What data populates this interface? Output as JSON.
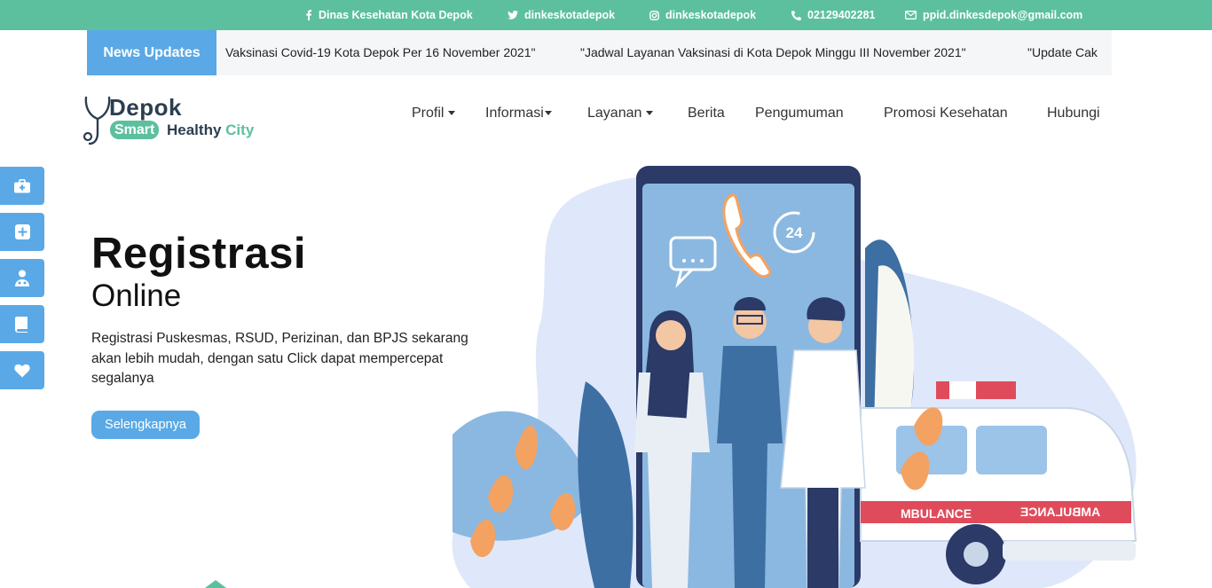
{
  "topbar": {
    "facebook": "Dinas Kesehatan Kota Depok",
    "twitter": "dinkeskotadepok",
    "instagram": "dinkeskotadepok",
    "phone": "02129402281",
    "email": "ppid.dinkesdepok@gmail.com"
  },
  "news": {
    "label": "News Updates",
    "items": [
      "Vaksinasi Covid-19 Kota Depok Per 16 November 2021\"",
      "\"Jadwal Layanan Vaksinasi di Kota Depok Minggu III November 2021\"",
      "\"Update Cak"
    ]
  },
  "logo": {
    "depok": "Depok",
    "smart": "Smart",
    "healthy": "Healthy",
    "city": "City"
  },
  "nav": {
    "items": [
      "Profil",
      "Informasi",
      "Layanan",
      "Berita",
      "Pengumuman",
      "Promosi Kesehatan",
      "Hubungi"
    ]
  },
  "side_icons": [
    "medkit-icon",
    "plus-square-icon",
    "doctor-icon",
    "book-icon",
    "heart-icon"
  ],
  "hero": {
    "title": "Registrasi",
    "subtitle": "Online",
    "description": "Registrasi Puskesmas, RSUD, Perizinan, dan BPJS sekarang akan lebih mudah, dengan satu Click dapat mempercepat segalanya",
    "button": "Selengkapnya"
  },
  "illustration": {
    "badge": "24",
    "ambulance_text": "AMBULANCE",
    "ambulance_side_text": "MBULANCE"
  },
  "colors": {
    "topbar": "#5cc09e",
    "accent_blue": "#5aa9e6",
    "logo_dark": "#2c3e50"
  }
}
